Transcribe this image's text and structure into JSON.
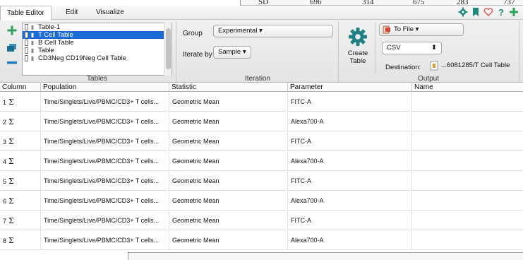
{
  "background_table": {
    "cells": [
      "SD",
      "696",
      "314",
      "675",
      "283",
      "737"
    ]
  },
  "tabs": [
    {
      "label": "Table Editor",
      "active": true
    },
    {
      "label": "Edit",
      "active": false
    },
    {
      "label": "Visualize",
      "active": false
    }
  ],
  "tab_icons": [
    "gear-icon",
    "bookmark-icon",
    "heart-icon",
    "help-icon",
    "plus-icon"
  ],
  "tables_group": {
    "label": "Tables",
    "items": [
      {
        "name": "Table-1",
        "selected": false
      },
      {
        "name": "T Cell Table",
        "selected": true
      },
      {
        "name": "B Cell Table",
        "selected": false
      },
      {
        "name": "Table",
        "selected": false
      },
      {
        "name": "CD3Neg CD19Neg Cell Table",
        "selected": false
      }
    ]
  },
  "iteration_group": {
    "label": "Iteration",
    "group_label": "Group",
    "group_value": "Experimental",
    "iterate_label": "Iterate by",
    "iterate_value": "Sample"
  },
  "output_group": {
    "label": "Output",
    "create_label_line1": "Create",
    "create_label_line2": "Table",
    "destination_type": "To File",
    "format": "CSV",
    "destination_label": "Destination:",
    "destination_value": "...6081285/T Cell Table"
  },
  "grid": {
    "headers": [
      "Column",
      "Population",
      "Statistic",
      "Parameter",
      "Name"
    ],
    "rows": [
      {
        "column": "1",
        "population": "Time/Singlets/Live/PBMC/CD3+ T cells...",
        "statistic": "Geometric Mean",
        "parameter": "FITC-A",
        "name": ""
      },
      {
        "column": "2",
        "population": "Time/Singlets/Live/PBMC/CD3+ T cells...",
        "statistic": "Geometric Mean",
        "parameter": "Alexa700-A",
        "name": ""
      },
      {
        "column": "3",
        "population": "Time/Singlets/Live/PBMC/CD3+ T cells...",
        "statistic": "Geometric Mean",
        "parameter": "FITC-A",
        "name": ""
      },
      {
        "column": "4",
        "population": "Time/Singlets/Live/PBMC/CD3+ T cells...",
        "statistic": "Geometric Mean",
        "parameter": "Alexa700-A",
        "name": ""
      },
      {
        "column": "5",
        "population": "Time/Singlets/Live/PBMC/CD3+ T cells...",
        "statistic": "Geometric Mean",
        "parameter": "FITC-A",
        "name": ""
      },
      {
        "column": "6",
        "population": "Time/Singlets/Live/PBMC/CD3+ T cells...",
        "statistic": "Geometric Mean",
        "parameter": "Alexa700-A",
        "name": ""
      },
      {
        "column": "7",
        "population": "Time/Singlets/Live/PBMC/CD3+ T cells...",
        "statistic": "Geometric Mean",
        "parameter": "FITC-A",
        "name": ""
      },
      {
        "column": "8",
        "population": "Time/Singlets/Live/PBMC/CD3+ T cells...",
        "statistic": "Geometric Mean",
        "parameter": "Alexa700-A",
        "name": ""
      }
    ]
  },
  "colors": {
    "selection": "#1b6bd6",
    "accent_teal": "#1f8a7a",
    "accent_green": "#2fa15a",
    "heart_red": "#d9534f"
  }
}
